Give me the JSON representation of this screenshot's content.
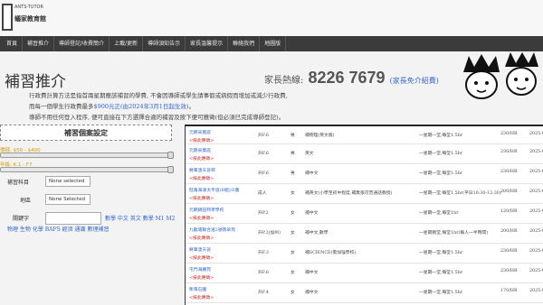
{
  "logo": {
    "title": "ANTS-TUTOR",
    "subtitle": "蟻家教育館"
  },
  "nav": [
    "首頁",
    "補習推介",
    "導師登記/收費簡介",
    "上載/更新",
    "導師須知告示",
    "家長溫馨提示",
    "聯絡我們",
    "地圖版"
  ],
  "page": {
    "title": "補習推介",
    "hotline_label": "家長熱線:",
    "hotline_number": "8226 7679",
    "hotline_free": "(家長免介紹費)",
    "intro_line1": "行政費計算方法是指首兩星期應該補習的學費, 不會因導師或學生請事假或病假而增加或減少行政費,",
    "intro_line2_a": "而每一個學生行政費最多",
    "intro_line2_b": "$900元正(由2024年3月1日起生效)",
    "intro_line2_c": "。",
    "intro_line3": "導師不用任何登入程序, 便可直接在下方選擇合適的補習及按下便可應徵(但必須已完成導師登記)。"
  },
  "filters": {
    "title": "補習個案設定",
    "price_range": "價錢: $50 - $400",
    "grade_range": "年級: K.1 - F7",
    "subject_label": "補習科目",
    "subject_value": "None selected",
    "area_label": "地區",
    "area_value": "None Selected",
    "keyword_label": "關鍵字",
    "quick_subjects_line1": "數學 中文 英文 數學 M1 M2",
    "quick_subjects_line2": "物理 生物 化學 BAFS 經濟 通識 數理補習"
  },
  "cases": [
    {
      "location": "元朗采葉庭",
      "apply": "<按此應徵>",
      "grade": "升F.6",
      "gender": "男",
      "subject": "補物理(英文版)",
      "schedule": "一星期一堂,每堂1.5hr",
      "price": "230/HR",
      "date": "2025-07-25"
    },
    {
      "location": "元朗采葉庭",
      "apply": "<按此應徵>",
      "grade": "升F.6",
      "gender": "男",
      "subject": "英文",
      "schedule": "一星期一堂,每堂1.5hr",
      "price": "230/HR",
      "date": "2025-07-25"
    },
    {
      "location": "將軍澳天晉邨",
      "apply": "<按此應徵>",
      "grade": "升F.6",
      "gender": "男",
      "subject": "補中文",
      "schedule": "一星期一堂,每堂1.5hr",
      "price": "230/HR",
      "date": "2025-07-25"
    },
    {
      "location": "旺角海濱太平道(B組)/E舊",
      "apply": "<按此應徵>",
      "grade": "成人",
      "gender": "女",
      "subject": "補英文(小學至初中程度,補無張可普通話教授)",
      "schedule": "一星期一堂,每堂1.5hr(平日10:30-12:30)",
      "price": "200/HR",
      "date": "2025-07-25"
    },
    {
      "location": "元朗錦田邦孝學校",
      "apply": "<按此應徵>",
      "grade": "升P.2",
      "gender": "女",
      "subject": "補中文",
      "schedule": "一星期一堂,每堂1hr",
      "price": "120/HR",
      "date": "2025-07-25"
    },
    {
      "location": "九龍塘聯合道2號翡翠苑",
      "apply": "<按此應徵>",
      "grade": "升P.2(加州)",
      "gender": "女",
      "subject": "補中文,數學",
      "schedule": "一星期兩堂,每堂1hr(每人一半時間)",
      "price": "200/HR",
      "date": "2025-07-25"
    },
    {
      "location": "將軍澳天晉",
      "apply": "<按此應徵>",
      "grade": "升F.3",
      "gender": "女",
      "subject": "補SCIENCE(需加強學校)",
      "schedule": "一星期一堂,每堂1.5hr",
      "price": "230/HR",
      "date": "2025-07-25"
    },
    {
      "location": "屯門海麗苑",
      "apply": "<按此應徵>",
      "grade": "升F.6",
      "gender": "女",
      "subject": "補中文",
      "schedule": "一星期一堂,每堂1.5hr",
      "price": "230/HR",
      "date": "2025-07-25"
    },
    {
      "location": "柴灣石園",
      "apply": "<按此應徵>",
      "grade": "升F.4",
      "gender": "女",
      "subject": "補中文",
      "schedule": "一星期一堂,每堂1.5hr",
      "price": "170/HR",
      "date": "2025-07-25"
    }
  ]
}
